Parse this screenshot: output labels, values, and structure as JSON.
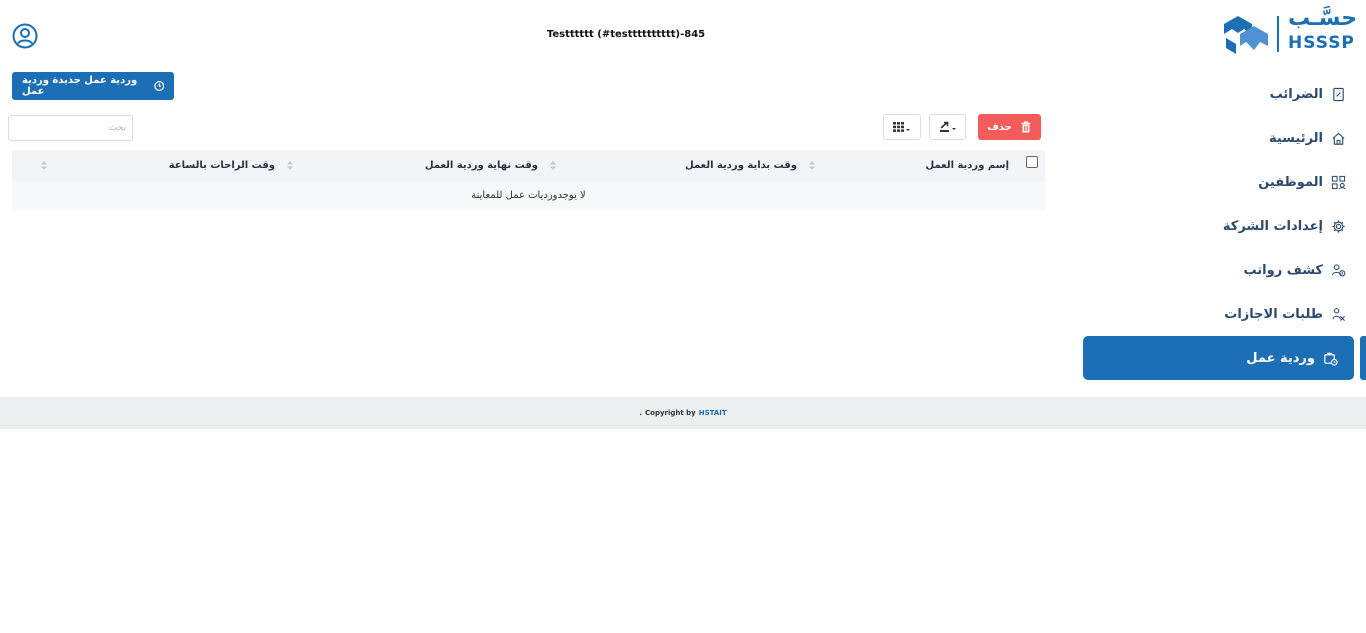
{
  "header": {
    "company_title": "Testttttt (#testttttttttt)-845",
    "logo_arabic": "حسَّـب",
    "logo_latin": "HSSSP"
  },
  "sidebar": {
    "items": [
      {
        "label": "الضرائب",
        "icon": "receipt-icon"
      },
      {
        "label": "الرئيسية",
        "icon": "home-icon"
      },
      {
        "label": "الموظفين",
        "icon": "employees-icon"
      },
      {
        "label": "إعدادات الشركة",
        "icon": "gear-icon"
      },
      {
        "label": "كشف رواتب",
        "icon": "payroll-icon"
      },
      {
        "label": "طلبات الاجازات",
        "icon": "leave-icon"
      }
    ],
    "active": {
      "label": "وردية عمل",
      "icon": "shift-icon"
    }
  },
  "toolbar": {
    "new_shift_label": "وردية عمل جديدة وردية عمل",
    "delete_label": "حذف",
    "search_placeholder": "بحث"
  },
  "table": {
    "columns": [
      "إسم وردية العمل",
      "وقت بداية وردية العمل",
      "وقت نهاية وردية العمل",
      "وقت الراحات بالساعة"
    ],
    "empty_message": "لا يوجدورديات عمل للمعاينة"
  },
  "footer": {
    "copyright_prefix": "Copyright by",
    "company_link": "HSTAIT",
    "suffix": "."
  },
  "colors": {
    "primary": "#1c6fb4",
    "danger": "#f45b5b"
  }
}
